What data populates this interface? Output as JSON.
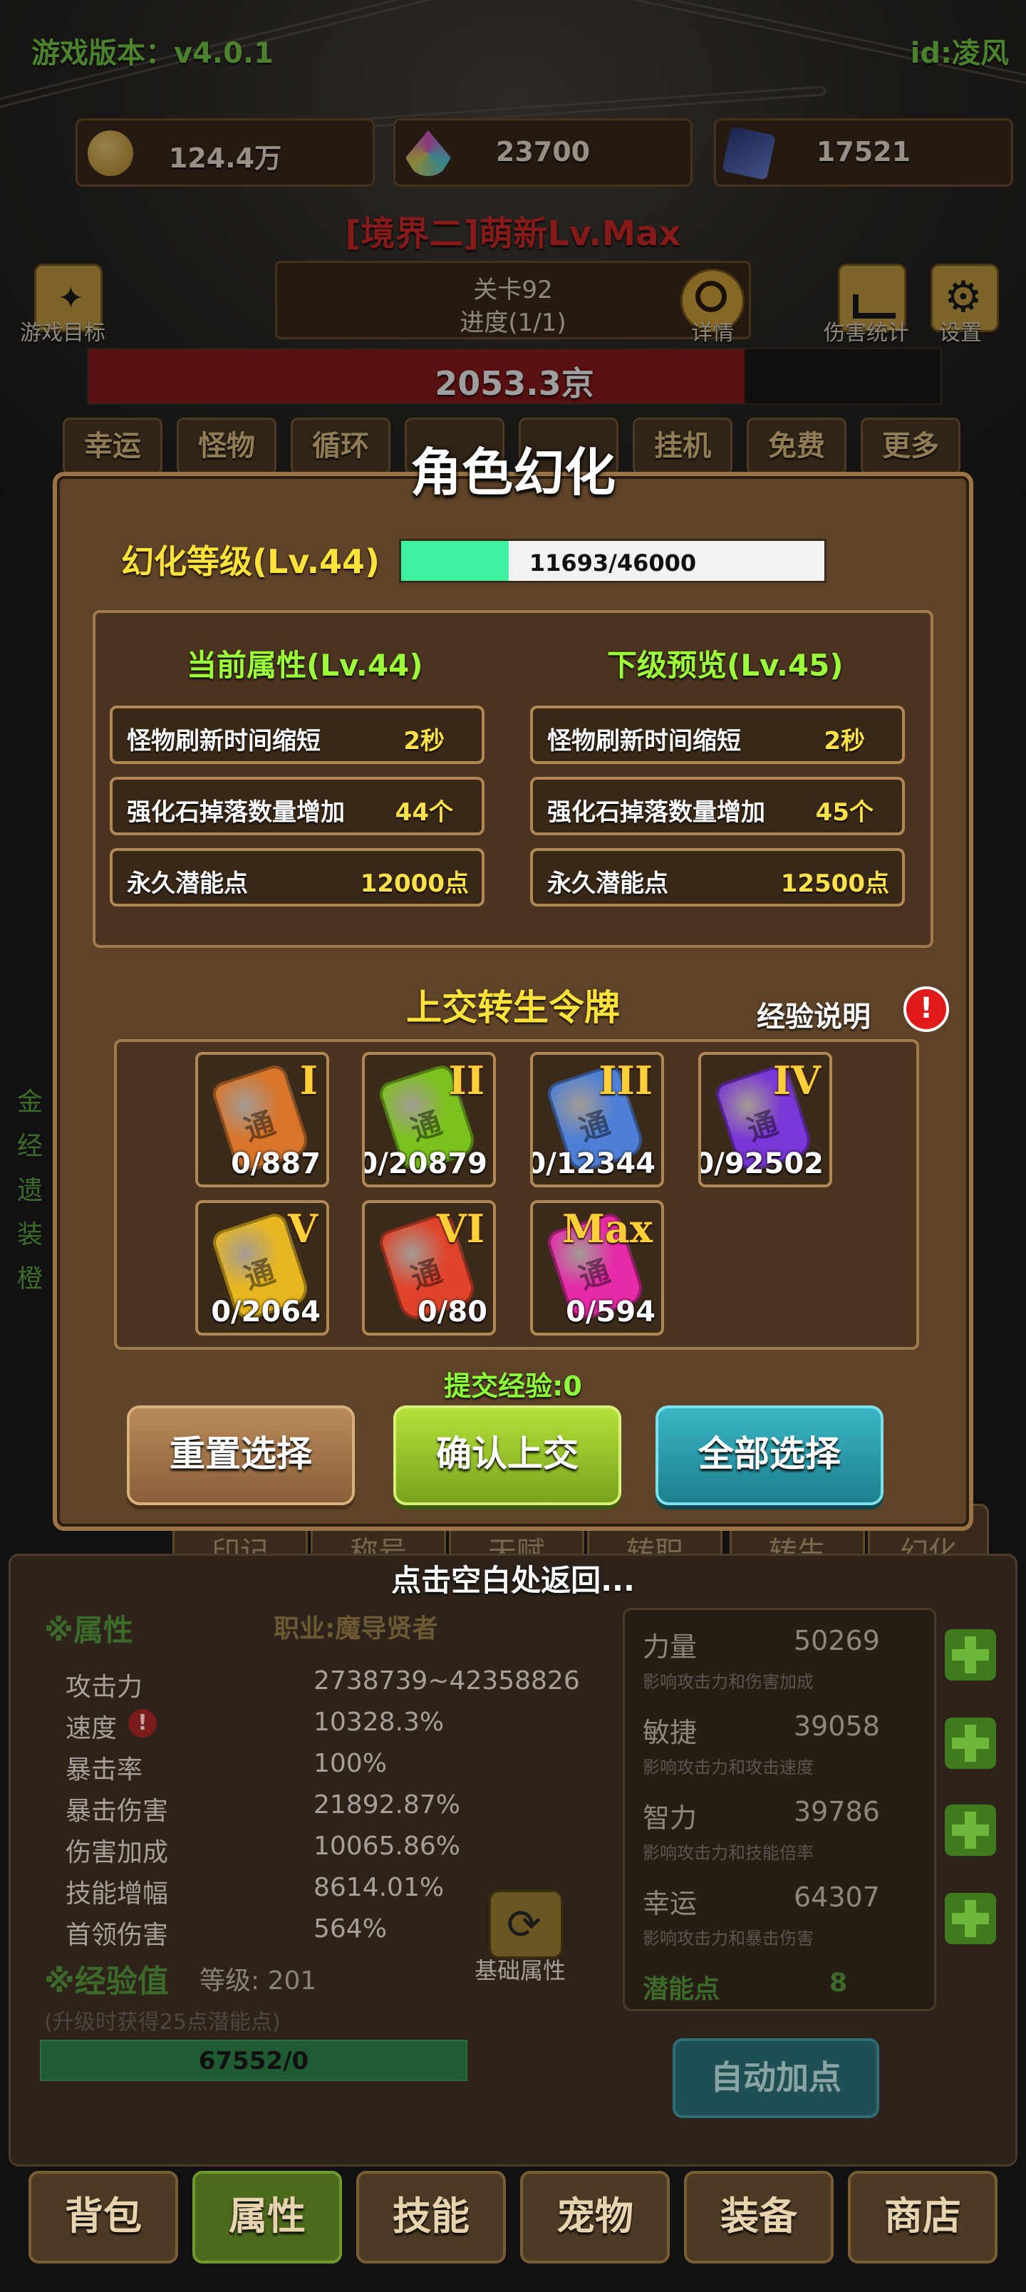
{
  "header": {
    "version": "游戏版本：v4.0.1",
    "player_id": "id:凌风"
  },
  "resources": [
    {
      "icon": "coin-icon",
      "value": "124.4万"
    },
    {
      "icon": "crystal-icon",
      "value": "23700"
    },
    {
      "icon": "card-icon",
      "value": "17521"
    }
  ],
  "realm_title": "[境界二]萌新Lv.Max",
  "stage": {
    "name": "关卡92",
    "progress": "进度(1/1)",
    "details_label": "详情",
    "hp_text": "2053.3京",
    "hp_fraction": 0.77
  },
  "top_icons": {
    "goal": "游戏目标",
    "damage_stats": "伤害统计",
    "settings": "设置"
  },
  "top_tabs": [
    "幸运",
    "怪物",
    "循环",
    "",
    "",
    "挂机",
    "免费",
    "更多"
  ],
  "modal": {
    "title": "角色幻化",
    "level_label": "幻化等级(Lv.44)",
    "exp_text": "11693/46000",
    "exp_fraction": 0.254,
    "current": {
      "title": "当前属性(Lv.44)",
      "rows": [
        {
          "label": "怪物刷新时间缩短",
          "value": "2秒"
        },
        {
          "label": "强化石掉落数量增加",
          "value": "44个"
        },
        {
          "label": "永久潜能点",
          "value": "12000点"
        }
      ]
    },
    "next": {
      "title": "下级预览(Lv.45)",
      "rows": [
        {
          "label": "怪物刷新时间缩短",
          "value": "2秒"
        },
        {
          "label": "强化石掉落数量增加",
          "value": "45个"
        },
        {
          "label": "永久潜能点",
          "value": "12500点"
        }
      ]
    },
    "tokens_title": "上交转生令牌",
    "exp_help": "经验说明",
    "tokens": [
      {
        "tier": "I",
        "count": "0/887",
        "color": "#d8752a"
      },
      {
        "tier": "II",
        "count": "0/20879",
        "color": "#7cc21e"
      },
      {
        "tier": "III",
        "count": "0/12344",
        "color": "#4d7fd6"
      },
      {
        "tier": "IV",
        "count": "0/92502",
        "color": "#7a36d6"
      },
      {
        "tier": "V",
        "count": "0/2064",
        "color": "#e8b720"
      },
      {
        "tier": "VI",
        "count": "0/80",
        "color": "#e0442b"
      },
      {
        "tier": "Max",
        "count": "0/594",
        "color": "#e62aa8"
      }
    ],
    "submit_exp": "提交经验:0",
    "buttons": {
      "reset": "重置选择",
      "confirm": "确认上交",
      "select_all": "全部选择"
    }
  },
  "return_hint": "点击空白处返回...",
  "left_edge_labels": [
    "金",
    "经",
    "遗",
    "装",
    "橙"
  ],
  "mid_tabs": [
    "印记",
    "称号",
    "天赋",
    "转职",
    "转生",
    "幻化"
  ],
  "attributes": {
    "title": "※属性",
    "job": "职业:魔导贤者",
    "rows": [
      {
        "label": "攻击力",
        "value": "2738739~42358826"
      },
      {
        "label": "速度",
        "value": "10328.3%"
      },
      {
        "label": "暴击率",
        "value": "100%"
      },
      {
        "label": "暴击伤害",
        "value": "21892.87%"
      },
      {
        "label": "伤害加成",
        "value": "10065.86%"
      },
      {
        "label": "技能增幅",
        "value": "8614.01%"
      },
      {
        "label": "首领伤害",
        "value": "564%"
      }
    ],
    "exp_title": "※经验值",
    "exp_level": "等级: 201",
    "exp_note": "(升级时获得25点潜能点)",
    "exp_bar": "67552/0",
    "base_attr_label": "基础属性"
  },
  "potential": {
    "rows": [
      {
        "label": "力量",
        "value": "50269",
        "hint": "影响攻击力和伤害加成"
      },
      {
        "label": "敏捷",
        "value": "39058",
        "hint": "影响攻击力和攻击速度"
      },
      {
        "label": "智力",
        "value": "39786",
        "hint": "影响攻击力和技能倍率"
      },
      {
        "label": "幸运",
        "value": "64307",
        "hint": "影响攻击力和暴击伤害"
      }
    ],
    "points_label": "潜能点",
    "points_value": "8",
    "auto_button": "自动加点"
  },
  "bottom_nav": [
    "背包",
    "属性",
    "技能",
    "宠物",
    "装备",
    "商店"
  ]
}
